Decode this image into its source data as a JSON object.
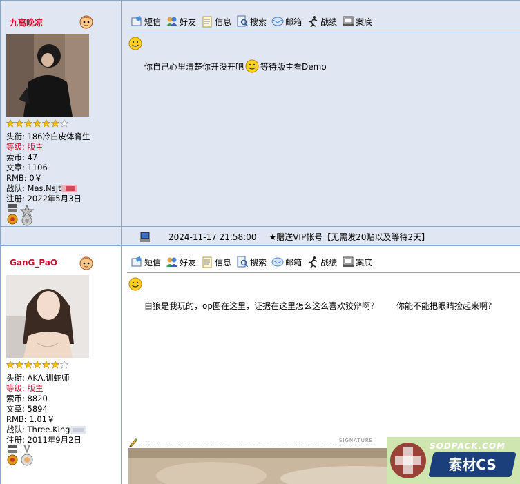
{
  "toolbar": {
    "items": [
      {
        "label": "短信",
        "icon": "sms-icon"
      },
      {
        "label": "好友",
        "icon": "friends-icon"
      },
      {
        "label": "信息",
        "icon": "profile-info-icon"
      },
      {
        "label": "搜索",
        "icon": "search-icon"
      },
      {
        "label": "邮箱",
        "icon": "mail-icon"
      },
      {
        "label": "战绩",
        "icon": "record-icon"
      },
      {
        "label": "案底",
        "icon": "case-record-icon"
      }
    ]
  },
  "post1": {
    "username": "九离晚凉",
    "stars": 6,
    "stars_total": 7,
    "title_label": "头衔:",
    "title_value": "186冷白皮体育生",
    "level_label": "等级:",
    "level_value": "版主",
    "coins_label": "索币:",
    "coins_value": "47",
    "posts_label": "文章:",
    "posts_value": "1106",
    "rmb_label": "RMB:",
    "rmb_value": "0￥",
    "clan_label": "战队:",
    "clan_value": "Mas.NsJt",
    "reg_label": "注册:",
    "reg_value": "2022年5月3日",
    "content_before": "你自己心里清楚你开没开吧",
    "content_after": "等待版主看Demo"
  },
  "separator": {
    "date": "2024-11-17 21:58:00",
    "ad": "★赠送VIP帐号【无需发20贴以及等待2天】"
  },
  "post2": {
    "username": "GanG_PaO",
    "stars": 6,
    "stars_total": 7,
    "title_label": "头衔:",
    "title_value": "AKA.训蛇师",
    "level_label": "等级:",
    "level_value": "版主",
    "coins_label": "索币:",
    "coins_value": "8820",
    "posts_label": "文章:",
    "posts_value": "5894",
    "rmb_label": "RMB:",
    "rmb_value": "1.01￥",
    "clan_label": "战队:",
    "clan_value": "Three.King",
    "reg_label": "注册:",
    "reg_value": "2011年9月2日",
    "content_part1": "白狼是我玩的，op图在这里，证据在这里怎么这么喜欢狡辩啊？",
    "content_part2": "你能不能把眼睛捡起来啊？",
    "signature_label": "SIGNATURE"
  },
  "watermark": {
    "url": "SODPACK.COM",
    "name": "素材CS"
  },
  "colors": {
    "post_bg": "#e1e7f2",
    "border": "#8aa6c8",
    "red": "#c8102e"
  }
}
